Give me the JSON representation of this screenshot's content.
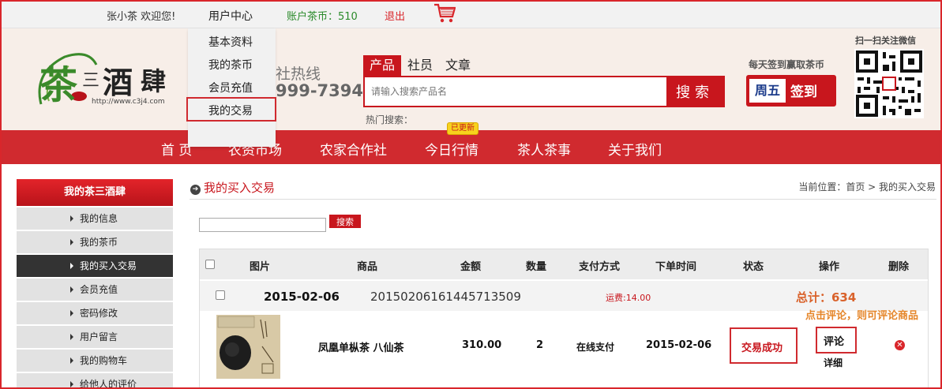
{
  "topbar": {
    "welcome": "张小茶 欢迎您!",
    "user_center": "用户中心",
    "coins": "账户茶币：510",
    "logout": "退出",
    "cart_icon": "shopping-cart-icon"
  },
  "dropdown": {
    "items": [
      "基本资料",
      "我的茶币",
      "会员充值",
      "我的交易"
    ]
  },
  "header": {
    "logo_chars": [
      "茶",
      "三",
      "酒",
      "肆"
    ],
    "logo_url": "http://www.c3j4.com",
    "hotline_label": "社热线",
    "hotline_number": "999-7394",
    "search_tabs": [
      "产品",
      "社员",
      "文章"
    ],
    "search_placeholder": "请输入搜索产品名",
    "search_button": "搜索",
    "hot_search": "热门搜索：",
    "signin_tip": "每天签到赢取茶币",
    "signin_day": "周五",
    "signin_label": "签到",
    "qr_tip": "扫一扫关注微信"
  },
  "nav": {
    "items": [
      "首 页",
      "农资市场",
      "农家合作社",
      "今日行情",
      "茶人茶事",
      "关于我们"
    ],
    "badge": "已更新"
  },
  "sidebar": {
    "title": "我的茶三酒肆",
    "items": [
      "我的信息",
      "我的茶币",
      "我的买入交易",
      "会员充值",
      "密码修改",
      "用户留言",
      "我的购物车",
      "给他人的评价"
    ]
  },
  "main": {
    "heading": "我的买入交易",
    "breadcrumb": "当前位置：首页 > 我的买入交易",
    "search_button": "搜索",
    "columns": [
      "图片",
      "商品",
      "金额",
      "数量",
      "支付方式",
      "下单时间",
      "状态",
      "操作",
      "删除"
    ],
    "order": {
      "date": "2015-02-06",
      "order_no": "20150206161445713509",
      "shipping": "运费:14.00",
      "total": "总计：634"
    },
    "item": {
      "name": "凤凰单枞茶 八仙茶",
      "price": "310.00",
      "quantity": "2",
      "payment": "在线支付",
      "order_date": "2015-02-06",
      "status": "交易成功",
      "review": "评论",
      "detail": "详细"
    },
    "hint": "点击评论，则可评论商品"
  },
  "colors": {
    "brand_red": "#d02a2f",
    "accent_orange": "#e5862a",
    "coin_green": "#2a8a2a"
  }
}
